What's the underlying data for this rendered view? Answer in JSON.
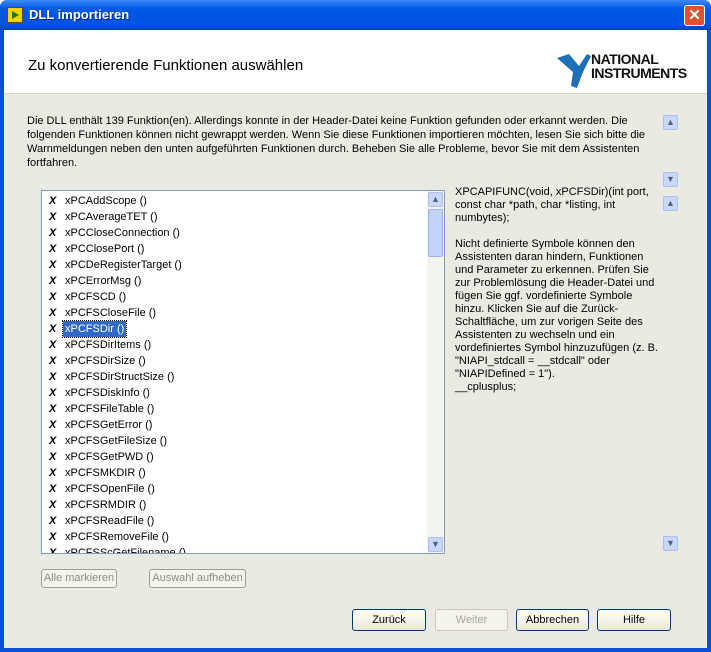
{
  "window": {
    "title": "DLL importieren"
  },
  "header": {
    "title": "Zu konvertierende Funktionen auswählen",
    "logo": "NATIONAL INSTRUMENTS"
  },
  "description": "Die DLL enthält 139 Funktion(en). Allerdings konnte in der Header-Datei keine Funktion gefunden oder erkannt werden. Die folgenden Funktionen können nicht gewrappt werden. Wenn Sie diese Funktionen importieren möchten, lesen Sie sich bitte die Warnmeldungen neben den unten aufgeführten Funktionen durch. Beheben Sie alle Probleme, bevor Sie mit dem Assistenten fortfahren.",
  "functions": [
    "xPCAddScope ()",
    "xPCAverageTET ()",
    "xPCCloseConnection ()",
    "xPCClosePort ()",
    "xPCDeRegisterTarget ()",
    "xPCErrorMsg ()",
    "xPCFSCD ()",
    "xPCFSCloseFile ()",
    "xPCFSDir ()",
    "xPCFSDirItems ()",
    "xPCFSDirSize ()",
    "xPCFSDirStructSize ()",
    "xPCFSDiskInfo ()",
    "xPCFSFileTable ()",
    "xPCFSGetError ()",
    "xPCFSGetFileSize ()",
    "xPCFSGetPWD ()",
    "xPCFSMKDIR ()",
    "xPCFSOpenFile ()",
    "xPCFSRMDIR ()",
    "xPCFSReadFile ()",
    "xPCFSRemoveFile ()",
    "xPCFSScGetFilename ()"
  ],
  "selected_function": "xPCFSDir ()",
  "error_mark": "X",
  "info": {
    "signature": "XPCAPIFUNC(void, xPCFSDir)(int port, const char *path, char *listing, int numbytes);",
    "message": "Nicht definierte Symbole können den Assistenten daran hindern, Funktionen und Parameter zu erkennen. Prüfen Sie zur Problemlösung die Header-Datei und fügen Sie ggf. vordefinierte Symbole hinzu. Klicken Sie auf die Zurück-Schaltfläche, um zur vorigen Seite des Assistenten zu wechseln und ein vordefiniertes Symbol hinzuzufügen (z. B. \"NIAPI_stdcall = __stdcall\" oder \"NIAPIDefined = 1\").",
    "symbol": "__cplusplus;"
  },
  "buttons": {
    "select_all": "Alle markieren",
    "deselect": "Auswahl aufheben",
    "back": "Zurück",
    "next": "Weiter",
    "cancel": "Abbrechen",
    "help": "Hilfe"
  }
}
